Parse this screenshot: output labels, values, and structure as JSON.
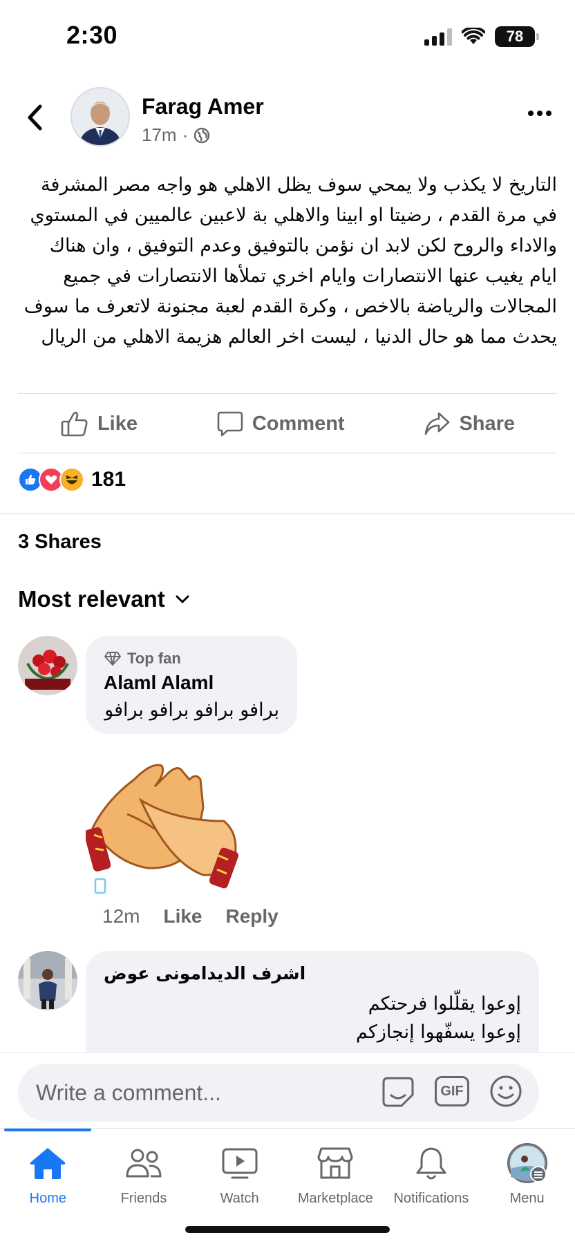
{
  "status_bar": {
    "time": "2:30",
    "battery": "78"
  },
  "post": {
    "author": "Farag Amer",
    "time": "17m",
    "separator": "·",
    "body": "التاريخ لا يكذب ولا يمحي سوف يظل الاهلي هو واجه مصر المشرفة في مرة القدم ، رضيتا او ابينا والاهلي بة لاعبين عالميين في المستوي والاداء والروح لكن لابد ان نؤمن بالتوفيق وعدم التوفيق ، وان هناك ايام يغيب عنها الانتصارات وايام اخري تملأها الانتصارات في جميع المجالات والرياضة بالاخص ، وكرة القدم لعبة مجنونة لاتعرف ما سوف يحدث مما هو حال الدنيا ، ليست اخر العالم هزيمة الاهلي من الريال"
  },
  "actions": {
    "like": "Like",
    "comment": "Comment",
    "share": "Share"
  },
  "reactions": {
    "count": "181"
  },
  "shares": "3 Shares",
  "sort": {
    "label": "Most relevant"
  },
  "comments": [
    {
      "badge": "Top fan",
      "name": "Alaml Alaml",
      "text": "برافو برافو برافو برافو",
      "time": "12m",
      "like": "Like",
      "reply": "Reply"
    },
    {
      "name": "اشرف الديدامونى عوض",
      "line1": "إوعوا يقلّلوا فرحتكم",
      "line2": "إوعوا يسفّهوا إنجازكم"
    }
  ],
  "composer": {
    "placeholder": "Write a comment...",
    "gif": "GIF"
  },
  "tabs": [
    {
      "label": "Home",
      "icon": "home-icon",
      "active": true
    },
    {
      "label": "Friends",
      "icon": "friends-icon"
    },
    {
      "label": "Watch",
      "icon": "watch-icon"
    },
    {
      "label": "Marketplace",
      "icon": "marketplace-icon"
    },
    {
      "label": "Notifications",
      "icon": "bell-icon"
    },
    {
      "label": "Menu",
      "icon": "menu-avatar-icon"
    }
  ],
  "colors": {
    "accent": "#1877f2",
    "secondary_text": "#65676b",
    "bubble": "#f0f2f5"
  }
}
